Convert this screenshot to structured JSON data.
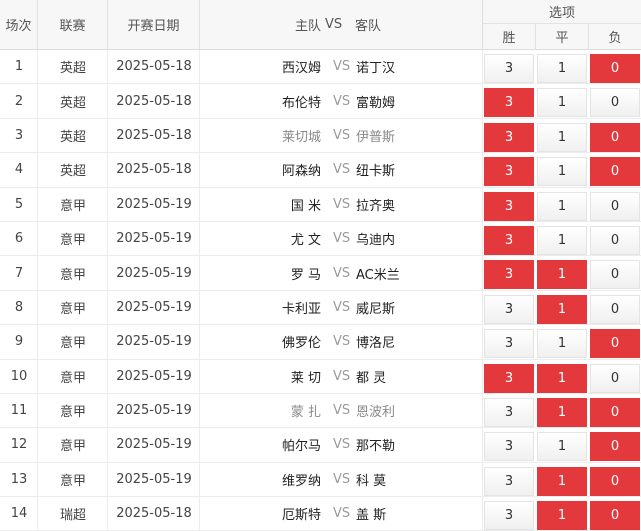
{
  "header": {
    "no": "场次",
    "league": "联赛",
    "date": "开赛日期",
    "home": "主队",
    "vs": "VS",
    "away": "客队",
    "options": "选项",
    "win": "胜",
    "draw": "平",
    "lose": "负"
  },
  "colors": {
    "selected": "#e4393c"
  },
  "rows": [
    {
      "no": "1",
      "league": "英超",
      "date": "2025-05-18",
      "home": "西汉姆",
      "vs": "VS",
      "away": "诺丁汉",
      "odds": [
        "3",
        "1",
        "0"
      ],
      "selected": [
        false,
        false,
        true
      ],
      "dim": false
    },
    {
      "no": "2",
      "league": "英超",
      "date": "2025-05-18",
      "home": "布伦特",
      "vs": "VS",
      "away": "富勒姆",
      "odds": [
        "3",
        "1",
        "0"
      ],
      "selected": [
        true,
        false,
        false
      ],
      "dim": false
    },
    {
      "no": "3",
      "league": "英超",
      "date": "2025-05-18",
      "home": "莱切城",
      "vs": "VS",
      "away": "伊普斯",
      "odds": [
        "3",
        "1",
        "0"
      ],
      "selected": [
        true,
        false,
        true
      ],
      "dim": true
    },
    {
      "no": "4",
      "league": "英超",
      "date": "2025-05-18",
      "home": "阿森纳",
      "vs": "VS",
      "away": "纽卡斯",
      "odds": [
        "3",
        "1",
        "0"
      ],
      "selected": [
        true,
        false,
        true
      ],
      "dim": false
    },
    {
      "no": "5",
      "league": "意甲",
      "date": "2025-05-19",
      "home": "国 米",
      "vs": "VS",
      "away": "拉齐奥",
      "odds": [
        "3",
        "1",
        "0"
      ],
      "selected": [
        true,
        false,
        false
      ],
      "dim": false
    },
    {
      "no": "6",
      "league": "意甲",
      "date": "2025-05-19",
      "home": "尤 文",
      "vs": "VS",
      "away": "乌迪内",
      "odds": [
        "3",
        "1",
        "0"
      ],
      "selected": [
        true,
        false,
        false
      ],
      "dim": false
    },
    {
      "no": "7",
      "league": "意甲",
      "date": "2025-05-19",
      "home": "罗 马",
      "vs": "VS",
      "away": "AC米兰",
      "odds": [
        "3",
        "1",
        "0"
      ],
      "selected": [
        true,
        true,
        false
      ],
      "dim": false
    },
    {
      "no": "8",
      "league": "意甲",
      "date": "2025-05-19",
      "home": "卡利亚",
      "vs": "VS",
      "away": "威尼斯",
      "odds": [
        "3",
        "1",
        "0"
      ],
      "selected": [
        false,
        true,
        false
      ],
      "dim": false
    },
    {
      "no": "9",
      "league": "意甲",
      "date": "2025-05-19",
      "home": "佛罗伦",
      "vs": "VS",
      "away": "博洛尼",
      "odds": [
        "3",
        "1",
        "0"
      ],
      "selected": [
        false,
        false,
        true
      ],
      "dim": false
    },
    {
      "no": "10",
      "league": "意甲",
      "date": "2025-05-19",
      "home": "莱 切",
      "vs": "VS",
      "away": "都 灵",
      "odds": [
        "3",
        "1",
        "0"
      ],
      "selected": [
        true,
        true,
        false
      ],
      "dim": false
    },
    {
      "no": "11",
      "league": "意甲",
      "date": "2025-05-19",
      "home": "蒙 扎",
      "vs": "VS",
      "away": "恩波利",
      "odds": [
        "3",
        "1",
        "0"
      ],
      "selected": [
        false,
        true,
        true
      ],
      "dim": true
    },
    {
      "no": "12",
      "league": "意甲",
      "date": "2025-05-19",
      "home": "帕尔马",
      "vs": "VS",
      "away": "那不勒",
      "odds": [
        "3",
        "1",
        "0"
      ],
      "selected": [
        false,
        false,
        true
      ],
      "dim": false
    },
    {
      "no": "13",
      "league": "意甲",
      "date": "2025-05-19",
      "home": "维罗纳",
      "vs": "VS",
      "away": "科 莫",
      "odds": [
        "3",
        "1",
        "0"
      ],
      "selected": [
        false,
        true,
        true
      ],
      "dim": false
    },
    {
      "no": "14",
      "league": "瑞超",
      "date": "2025-05-18",
      "home": "厄斯特",
      "vs": "VS",
      "away": "盖 斯",
      "odds": [
        "3",
        "1",
        "0"
      ],
      "selected": [
        false,
        true,
        true
      ],
      "dim": false
    }
  ]
}
